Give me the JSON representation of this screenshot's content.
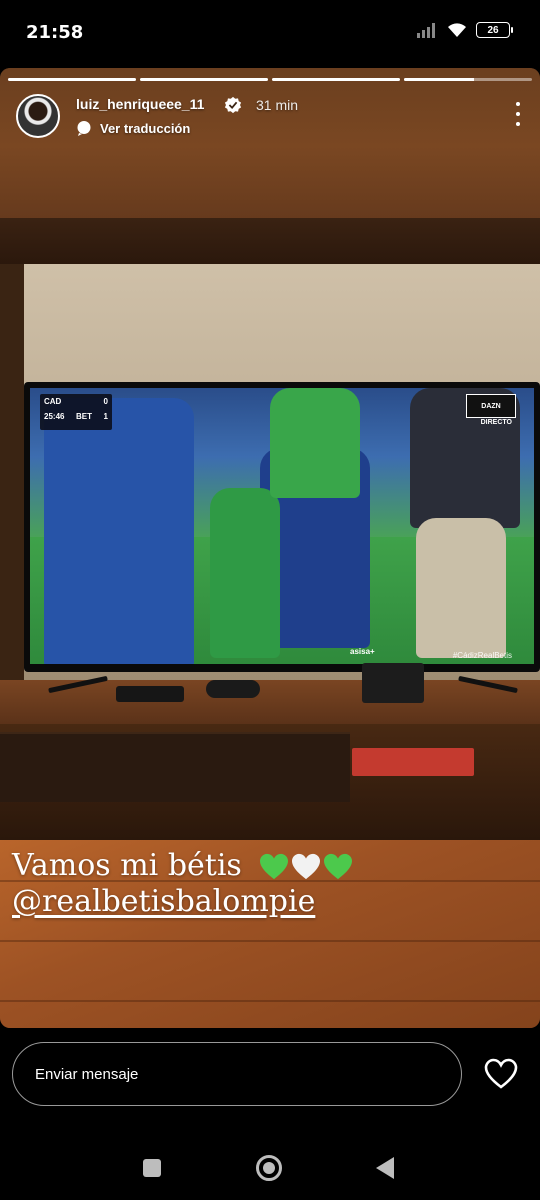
{
  "status_bar": {
    "time": "21:58",
    "battery": "26",
    "icons": [
      "signal-icon",
      "wifi-icon",
      "battery-icon"
    ]
  },
  "story": {
    "segments": [
      {
        "progress": 1.0
      },
      {
        "progress": 1.0
      },
      {
        "progress": 1.0
      },
      {
        "progress": 0.55
      }
    ],
    "username": "luiz_henriqueee_11",
    "verified": true,
    "time_ago": "31 min",
    "translate_label": "Ver traducción",
    "caption_line1": "Vamos mi bétis",
    "caption_hearts": [
      "💚",
      "🤍",
      "💚"
    ],
    "mention": "@realbetisbalompie",
    "tv": {
      "team1": "CAD",
      "score1": "0",
      "team2": "BET",
      "score2": "1",
      "clock": "25:46",
      "broadcaster": "DAZN",
      "live_label": "DIRECTO",
      "hashtag": "#CádizRealBetis",
      "sponsor": "asisa+"
    }
  },
  "composer": {
    "placeholder": "Enviar mensaje"
  },
  "colors": {
    "heart_green": "#4cc94c",
    "heart_white": "#f2f2f2"
  }
}
